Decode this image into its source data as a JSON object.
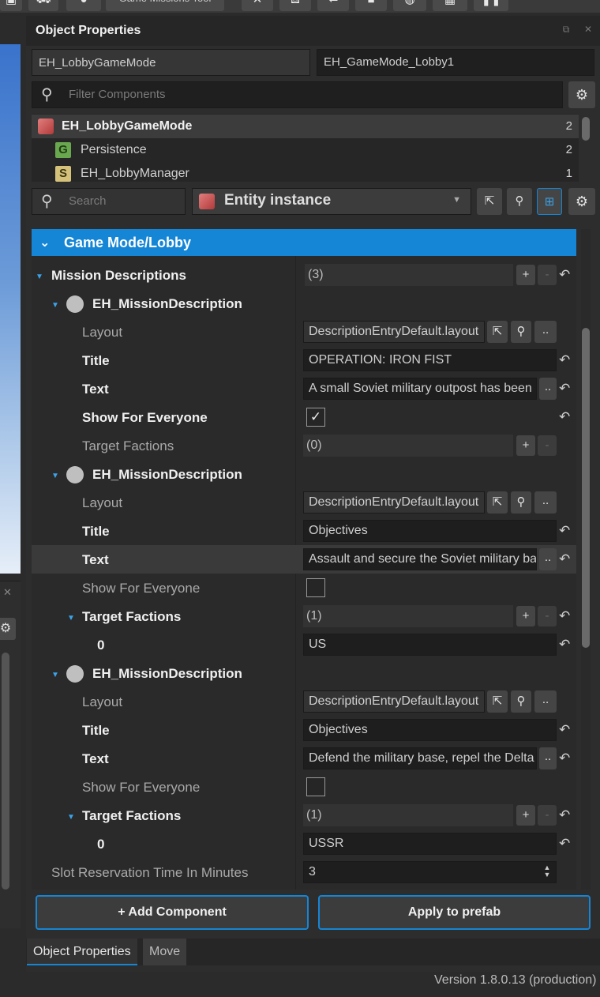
{
  "toolbar": {
    "label": "Game Missions Tool"
  },
  "panel": {
    "title": "Object Properties",
    "entity_class": "EH_LobbyGameMode",
    "entity_name": "EH_GameMode_Lobby1",
    "filter_placeholder": "Filter Components"
  },
  "components": [
    {
      "name": "EH_LobbyGameMode",
      "count": "2",
      "icon": "entity-cube-icon"
    },
    {
      "name": "Persistence",
      "count": "2",
      "icon": "component-g-icon",
      "letter": "G"
    },
    {
      "name": "EH_LobbyManager",
      "count": "1",
      "icon": "script-s-icon",
      "letter": "S"
    }
  ],
  "props_toolbar": {
    "search_placeholder": "Search",
    "mode": "Entity instance"
  },
  "section": {
    "title": "Game Mode/Lobby"
  },
  "mission_descriptions": {
    "label": "Mission Descriptions",
    "count": "(3)",
    "items": [
      {
        "name": "EH_MissionDescription",
        "layout_label": "Layout",
        "layout": "DescriptionEntryDefault.layout",
        "title_label": "Title",
        "title": "OPERATION: IRON FIST",
        "text_label": "Text",
        "text": "A small Soviet military outpost has been",
        "show_label": "Show For Everyone",
        "show": true,
        "factions_label": "Target Factions",
        "factions_count": "(0)",
        "factions": []
      },
      {
        "name": "EH_MissionDescription",
        "layout_label": "Layout",
        "layout": "DescriptionEntryDefault.layout",
        "title_label": "Title",
        "title": "Objectives",
        "text_label": "Text",
        "text": "Assault and secure the Soviet military base",
        "show_label": "Show For Everyone",
        "show": false,
        "factions_label": "Target Factions",
        "factions_count": "(1)",
        "factions": [
          {
            "index": "0",
            "value": "US"
          }
        ]
      },
      {
        "name": "EH_MissionDescription",
        "layout_label": "Layout",
        "layout": "DescriptionEntryDefault.layout",
        "title_label": "Title",
        "title": "Objectives",
        "text_label": "Text",
        "text": "Defend the military base, repel the Delta",
        "show_label": "Show For Everyone",
        "show": false,
        "factions_label": "Target Factions",
        "factions_count": "(1)",
        "factions": [
          {
            "index": "0",
            "value": "USSR"
          }
        ]
      }
    ]
  },
  "slot_reservation": {
    "label": "Slot Reservation Time In Minutes",
    "value": "3"
  },
  "buttons": {
    "add_component": "+ Add Component",
    "apply_prefab": "Apply to prefab",
    "more": ".."
  },
  "tabs": [
    "Object Properties",
    "Move"
  ],
  "version": "Version 1.8.0.13 (production)",
  "colors": {
    "accent": "#1585d6",
    "panel_bg": "#2d2d2d",
    "field_bg": "#1e1e1e"
  }
}
